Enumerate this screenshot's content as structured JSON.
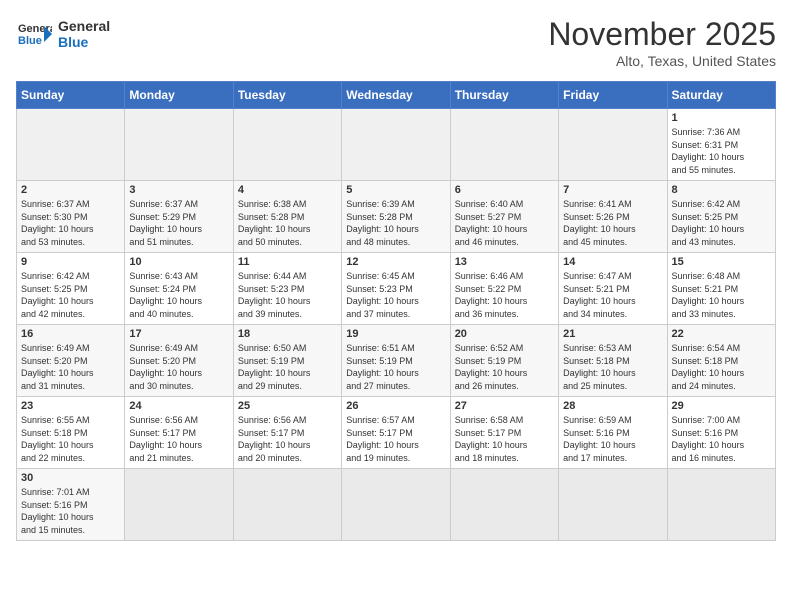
{
  "header": {
    "logo_line1": "General",
    "logo_line2": "Blue",
    "month": "November 2025",
    "location": "Alto, Texas, United States"
  },
  "weekdays": [
    "Sunday",
    "Monday",
    "Tuesday",
    "Wednesday",
    "Thursday",
    "Friday",
    "Saturday"
  ],
  "weeks": [
    [
      {
        "num": "",
        "info": ""
      },
      {
        "num": "",
        "info": ""
      },
      {
        "num": "",
        "info": ""
      },
      {
        "num": "",
        "info": ""
      },
      {
        "num": "",
        "info": ""
      },
      {
        "num": "",
        "info": ""
      },
      {
        "num": "1",
        "info": "Sunrise: 7:36 AM\nSunset: 6:31 PM\nDaylight: 10 hours\nand 55 minutes."
      }
    ],
    [
      {
        "num": "2",
        "info": "Sunrise: 6:37 AM\nSunset: 5:30 PM\nDaylight: 10 hours\nand 53 minutes."
      },
      {
        "num": "3",
        "info": "Sunrise: 6:37 AM\nSunset: 5:29 PM\nDaylight: 10 hours\nand 51 minutes."
      },
      {
        "num": "4",
        "info": "Sunrise: 6:38 AM\nSunset: 5:28 PM\nDaylight: 10 hours\nand 50 minutes."
      },
      {
        "num": "5",
        "info": "Sunrise: 6:39 AM\nSunset: 5:28 PM\nDaylight: 10 hours\nand 48 minutes."
      },
      {
        "num": "6",
        "info": "Sunrise: 6:40 AM\nSunset: 5:27 PM\nDaylight: 10 hours\nand 46 minutes."
      },
      {
        "num": "7",
        "info": "Sunrise: 6:41 AM\nSunset: 5:26 PM\nDaylight: 10 hours\nand 45 minutes."
      },
      {
        "num": "8",
        "info": "Sunrise: 6:42 AM\nSunset: 5:25 PM\nDaylight: 10 hours\nand 43 minutes."
      }
    ],
    [
      {
        "num": "9",
        "info": "Sunrise: 6:42 AM\nSunset: 5:25 PM\nDaylight: 10 hours\nand 42 minutes."
      },
      {
        "num": "10",
        "info": "Sunrise: 6:43 AM\nSunset: 5:24 PM\nDaylight: 10 hours\nand 40 minutes."
      },
      {
        "num": "11",
        "info": "Sunrise: 6:44 AM\nSunset: 5:23 PM\nDaylight: 10 hours\nand 39 minutes."
      },
      {
        "num": "12",
        "info": "Sunrise: 6:45 AM\nSunset: 5:23 PM\nDaylight: 10 hours\nand 37 minutes."
      },
      {
        "num": "13",
        "info": "Sunrise: 6:46 AM\nSunset: 5:22 PM\nDaylight: 10 hours\nand 36 minutes."
      },
      {
        "num": "14",
        "info": "Sunrise: 6:47 AM\nSunset: 5:21 PM\nDaylight: 10 hours\nand 34 minutes."
      },
      {
        "num": "15",
        "info": "Sunrise: 6:48 AM\nSunset: 5:21 PM\nDaylight: 10 hours\nand 33 minutes."
      }
    ],
    [
      {
        "num": "16",
        "info": "Sunrise: 6:49 AM\nSunset: 5:20 PM\nDaylight: 10 hours\nand 31 minutes."
      },
      {
        "num": "17",
        "info": "Sunrise: 6:49 AM\nSunset: 5:20 PM\nDaylight: 10 hours\nand 30 minutes."
      },
      {
        "num": "18",
        "info": "Sunrise: 6:50 AM\nSunset: 5:19 PM\nDaylight: 10 hours\nand 29 minutes."
      },
      {
        "num": "19",
        "info": "Sunrise: 6:51 AM\nSunset: 5:19 PM\nDaylight: 10 hours\nand 27 minutes."
      },
      {
        "num": "20",
        "info": "Sunrise: 6:52 AM\nSunset: 5:19 PM\nDaylight: 10 hours\nand 26 minutes."
      },
      {
        "num": "21",
        "info": "Sunrise: 6:53 AM\nSunset: 5:18 PM\nDaylight: 10 hours\nand 25 minutes."
      },
      {
        "num": "22",
        "info": "Sunrise: 6:54 AM\nSunset: 5:18 PM\nDaylight: 10 hours\nand 24 minutes."
      }
    ],
    [
      {
        "num": "23",
        "info": "Sunrise: 6:55 AM\nSunset: 5:18 PM\nDaylight: 10 hours\nand 22 minutes."
      },
      {
        "num": "24",
        "info": "Sunrise: 6:56 AM\nSunset: 5:17 PM\nDaylight: 10 hours\nand 21 minutes."
      },
      {
        "num": "25",
        "info": "Sunrise: 6:56 AM\nSunset: 5:17 PM\nDaylight: 10 hours\nand 20 minutes."
      },
      {
        "num": "26",
        "info": "Sunrise: 6:57 AM\nSunset: 5:17 PM\nDaylight: 10 hours\nand 19 minutes."
      },
      {
        "num": "27",
        "info": "Sunrise: 6:58 AM\nSunset: 5:17 PM\nDaylight: 10 hours\nand 18 minutes."
      },
      {
        "num": "28",
        "info": "Sunrise: 6:59 AM\nSunset: 5:16 PM\nDaylight: 10 hours\nand 17 minutes."
      },
      {
        "num": "29",
        "info": "Sunrise: 7:00 AM\nSunset: 5:16 PM\nDaylight: 10 hours\nand 16 minutes."
      }
    ],
    [
      {
        "num": "30",
        "info": "Sunrise: 7:01 AM\nSunset: 5:16 PM\nDaylight: 10 hours\nand 15 minutes."
      },
      {
        "num": "",
        "info": ""
      },
      {
        "num": "",
        "info": ""
      },
      {
        "num": "",
        "info": ""
      },
      {
        "num": "",
        "info": ""
      },
      {
        "num": "",
        "info": ""
      },
      {
        "num": "",
        "info": ""
      }
    ]
  ]
}
